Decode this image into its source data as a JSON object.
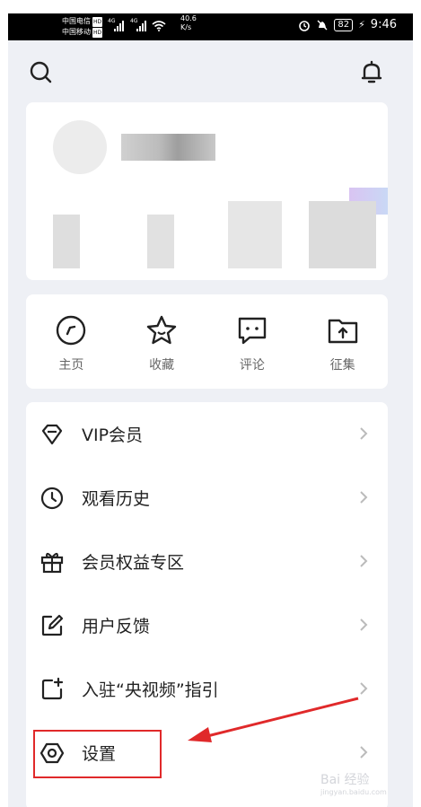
{
  "status_bar": {
    "carrier1": "中国电信",
    "carrier2": "中国移动",
    "hd": "HD",
    "net1": "4G",
    "net2": "4G",
    "speed": "40.6",
    "speed_unit": "K/s",
    "battery": "82",
    "time": "9:46"
  },
  "header": {
    "search_icon": "search-icon",
    "notify_icon": "bell-icon"
  },
  "profile": {
    "blurred": true
  },
  "quick_actions": [
    {
      "label": "主页",
      "icon": "compass-icon"
    },
    {
      "label": "收藏",
      "icon": "star-icon"
    },
    {
      "label": "评论",
      "icon": "comment-icon"
    },
    {
      "label": "征集",
      "icon": "folder-upload-icon"
    }
  ],
  "menu": [
    {
      "label": "VIP会员",
      "icon": "diamond-icon"
    },
    {
      "label": "观看历史",
      "icon": "clock-icon"
    },
    {
      "label": "会员权益专区",
      "icon": "gift-icon"
    },
    {
      "label": "用户反馈",
      "icon": "edit-icon"
    },
    {
      "label": "入驻“央视频”指引",
      "icon": "add-square-icon"
    },
    {
      "label": "设置",
      "icon": "settings-icon"
    }
  ],
  "annotation": {
    "color": "#e0292a"
  },
  "watermark": {
    "text": "Bai 经验",
    "sub": "jingyan.baidu.com"
  },
  "colors": {
    "background": "#eef0f5",
    "card": "#ffffff",
    "text": "#222222",
    "highlight": "#e0292a"
  }
}
